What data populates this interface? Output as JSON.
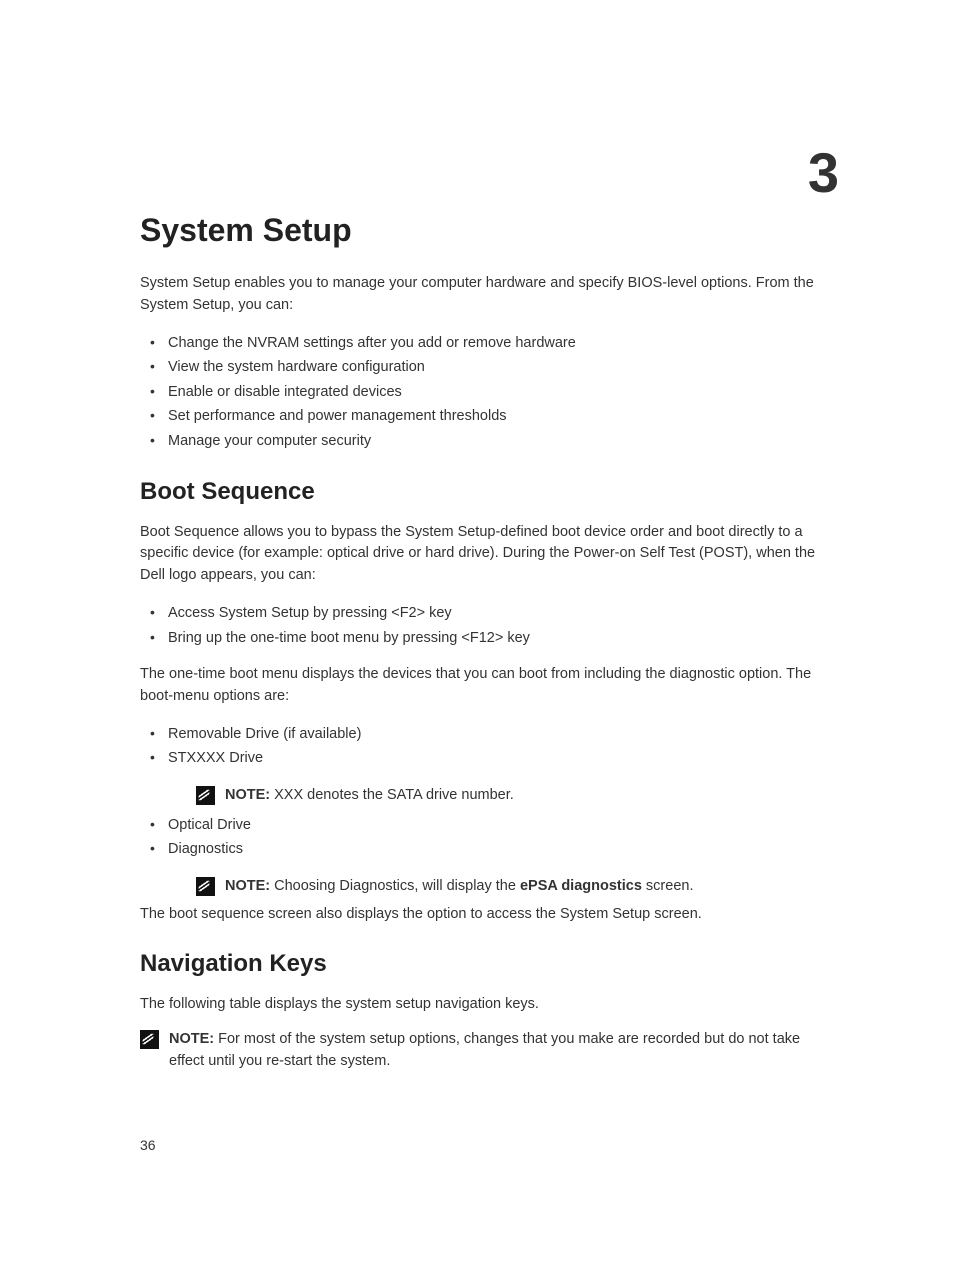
{
  "chapter_number": "3",
  "h1": "System Setup",
  "intro_para": "System Setup enables you to manage your computer hardware and specify BIOS-level options. From the System Setup, you can:",
  "intro_list": [
    "Change the NVRAM settings after you add or remove hardware",
    "View the system hardware configuration",
    "Enable or disable integrated devices",
    "Set performance and power management thresholds",
    "Manage your computer security"
  ],
  "boot": {
    "heading": "Boot Sequence",
    "para1": "Boot Sequence allows you to bypass the System Setup‐defined boot device order and boot directly to a specific device (for example: optical drive or hard drive). During the Power-on Self Test (POST), when the Dell logo appears, you can:",
    "list1": [
      "Access System Setup by pressing <F2> key",
      "Bring up the one-time boot menu by pressing <F12> key"
    ],
    "para2": "The one-time boot menu displays the devices that you can boot from including the diagnostic option. The boot-menu options are:",
    "list2_item1": "Removable Drive (if available)",
    "list2_item2": "STXXXX Drive",
    "note1_label": "NOTE:",
    "note1_text": " XXX denotes the SATA drive number.",
    "list2_item3": "Optical Drive",
    "list2_item4": "Diagnostics",
    "note2_label": "NOTE:",
    "note2_pre": " Choosing Diagnostics, will display the ",
    "note2_bold": "ePSA diagnostics",
    "note2_post": " screen.",
    "para3": "The boot sequence screen also displays the option to access the System Setup screen."
  },
  "nav": {
    "heading": "Navigation Keys",
    "para1": "The following table displays the system setup navigation keys.",
    "note_label": "NOTE:",
    "note_text": " For most of the system setup options, changes that you make are recorded but do not take effect until you re-start the system."
  },
  "page_number": "36"
}
